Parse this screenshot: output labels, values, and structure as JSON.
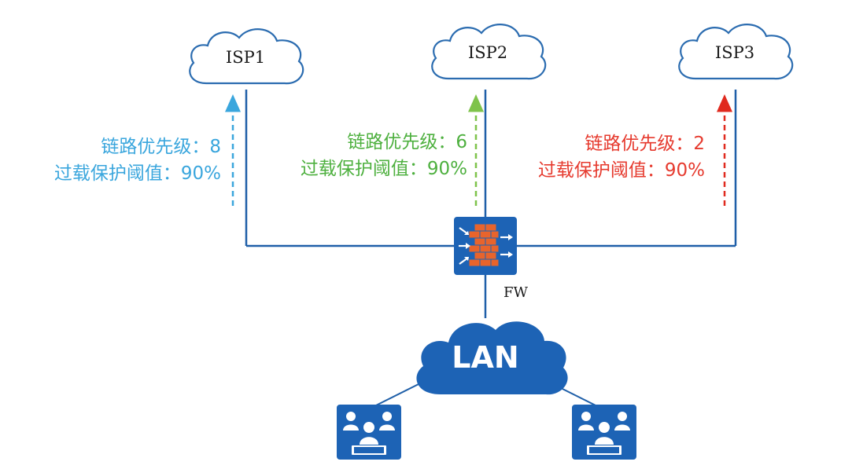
{
  "clouds": [
    {
      "label": "ISP1"
    },
    {
      "label": "ISP2"
    },
    {
      "label": "ISP3"
    }
  ],
  "params": [
    {
      "priority": "链路优先级：8",
      "threshold": "过载保护阈值：90%",
      "color": "#3aa6dd"
    },
    {
      "priority": "链路优先级：6",
      "threshold": "过载保护阈值：90%",
      "color": "#4eb03f"
    },
    {
      "priority": "链路优先级：2",
      "threshold": "过载保护阈值：90%",
      "color": "#e63a2e"
    }
  ],
  "firewall": {
    "label": "FW",
    "icon": "firewall-icon"
  },
  "lan": {
    "label": "LAN"
  },
  "groups": [
    {
      "icon": "user-group-icon"
    },
    {
      "icon": "user-group-icon"
    }
  ],
  "colors": {
    "line": "#1f5fa8",
    "cloud_stroke": "#2b6cb0",
    "lan_fill": "#1d63b5",
    "device_fill": "#1d63b5",
    "arrow_isp1": "#3aa6dd",
    "arrow_isp2": "#7fc34b",
    "arrow_isp3": "#e02a1f"
  }
}
